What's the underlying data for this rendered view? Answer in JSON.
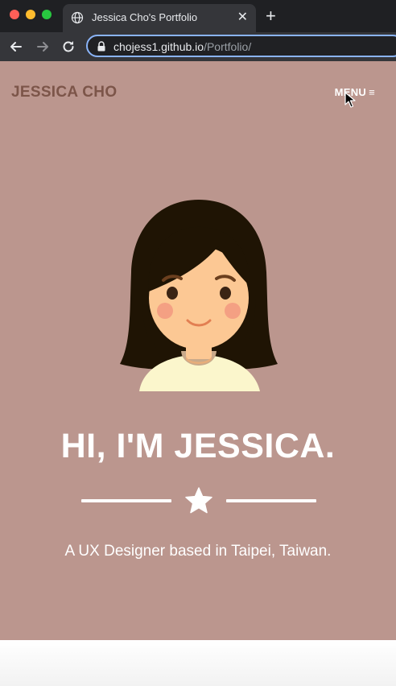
{
  "browser": {
    "tab_title": "Jessica Cho's Portfolio",
    "tab_close_icon": "close-icon",
    "new_tab_icon": "plus-icon",
    "url_host": "chojess1.github.io",
    "url_path": "/Portfolio/",
    "icons": [
      "globe-icon",
      "back-arrow-icon",
      "forward-arrow-icon",
      "reload-icon",
      "lock-icon"
    ]
  },
  "header": {
    "brand": "JESSICA CHO",
    "menu_label": "MENU",
    "menu_icon": "≡"
  },
  "hero": {
    "headline": "HI, I'M JESSICA.",
    "tagline": "A UX Designer based in Taipei, Taiwan.",
    "divider_icon": "star-icon"
  },
  "colors": {
    "hero_background": "#bb968e",
    "brand_text": "#7c5549",
    "chrome_dark": "#1f2023",
    "chrome_tab": "#35363a",
    "omnibox_focus": "#8ab4f8"
  }
}
